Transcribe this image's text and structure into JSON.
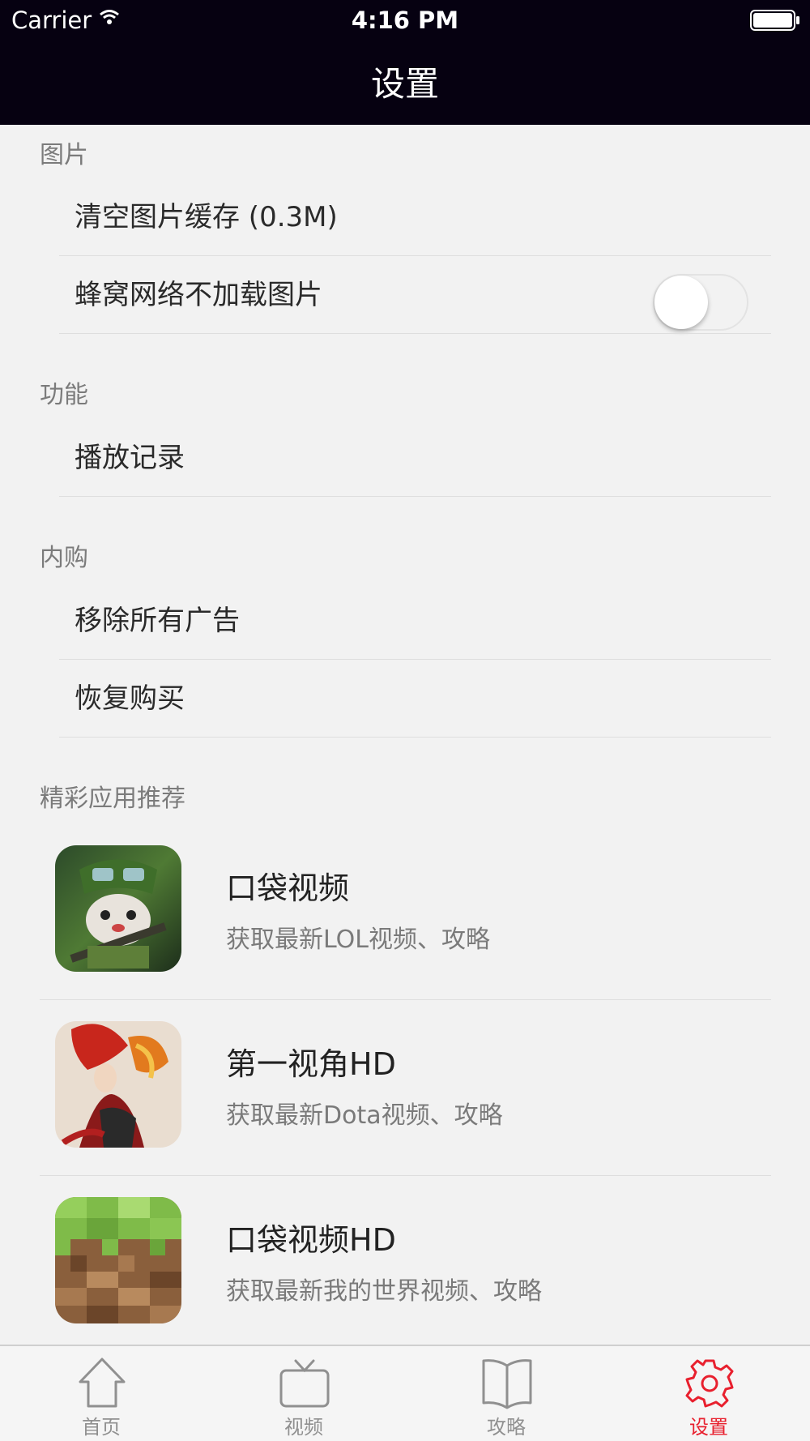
{
  "status_bar": {
    "carrier": "Carrier",
    "time": "4:16 PM"
  },
  "nav": {
    "title": "设置"
  },
  "sections": {
    "images": {
      "header": "图片",
      "clear_cache": "清空图片缓存 (0.3M)",
      "cellular_no_images": "蜂窝网络不加载图片",
      "cellular_no_images_on": false
    },
    "features": {
      "header": "功能",
      "play_history": "播放记录"
    },
    "purchase": {
      "header": "内购",
      "remove_ads": "移除所有广告",
      "restore": "恢复购买"
    },
    "apps": {
      "header": "精彩应用推荐",
      "items": [
        {
          "name": "口袋视频",
          "desc": "获取最新LOL视频、攻略"
        },
        {
          "name": "第一视角HD",
          "desc": "获取最新Dota视频、攻略"
        },
        {
          "name": "口袋视频HD",
          "desc": "获取最新我的世界视频、攻略"
        }
      ]
    }
  },
  "tabbar": {
    "items": [
      {
        "label": "首页",
        "icon": "home-icon"
      },
      {
        "label": "视频",
        "icon": "tv-icon"
      },
      {
        "label": "攻略",
        "icon": "book-icon"
      },
      {
        "label": "设置",
        "icon": "gear-icon"
      }
    ],
    "active_index": 3
  },
  "colors": {
    "nav_bg": "#060111",
    "accent": "#e8202e",
    "background": "#f2f2f2"
  }
}
